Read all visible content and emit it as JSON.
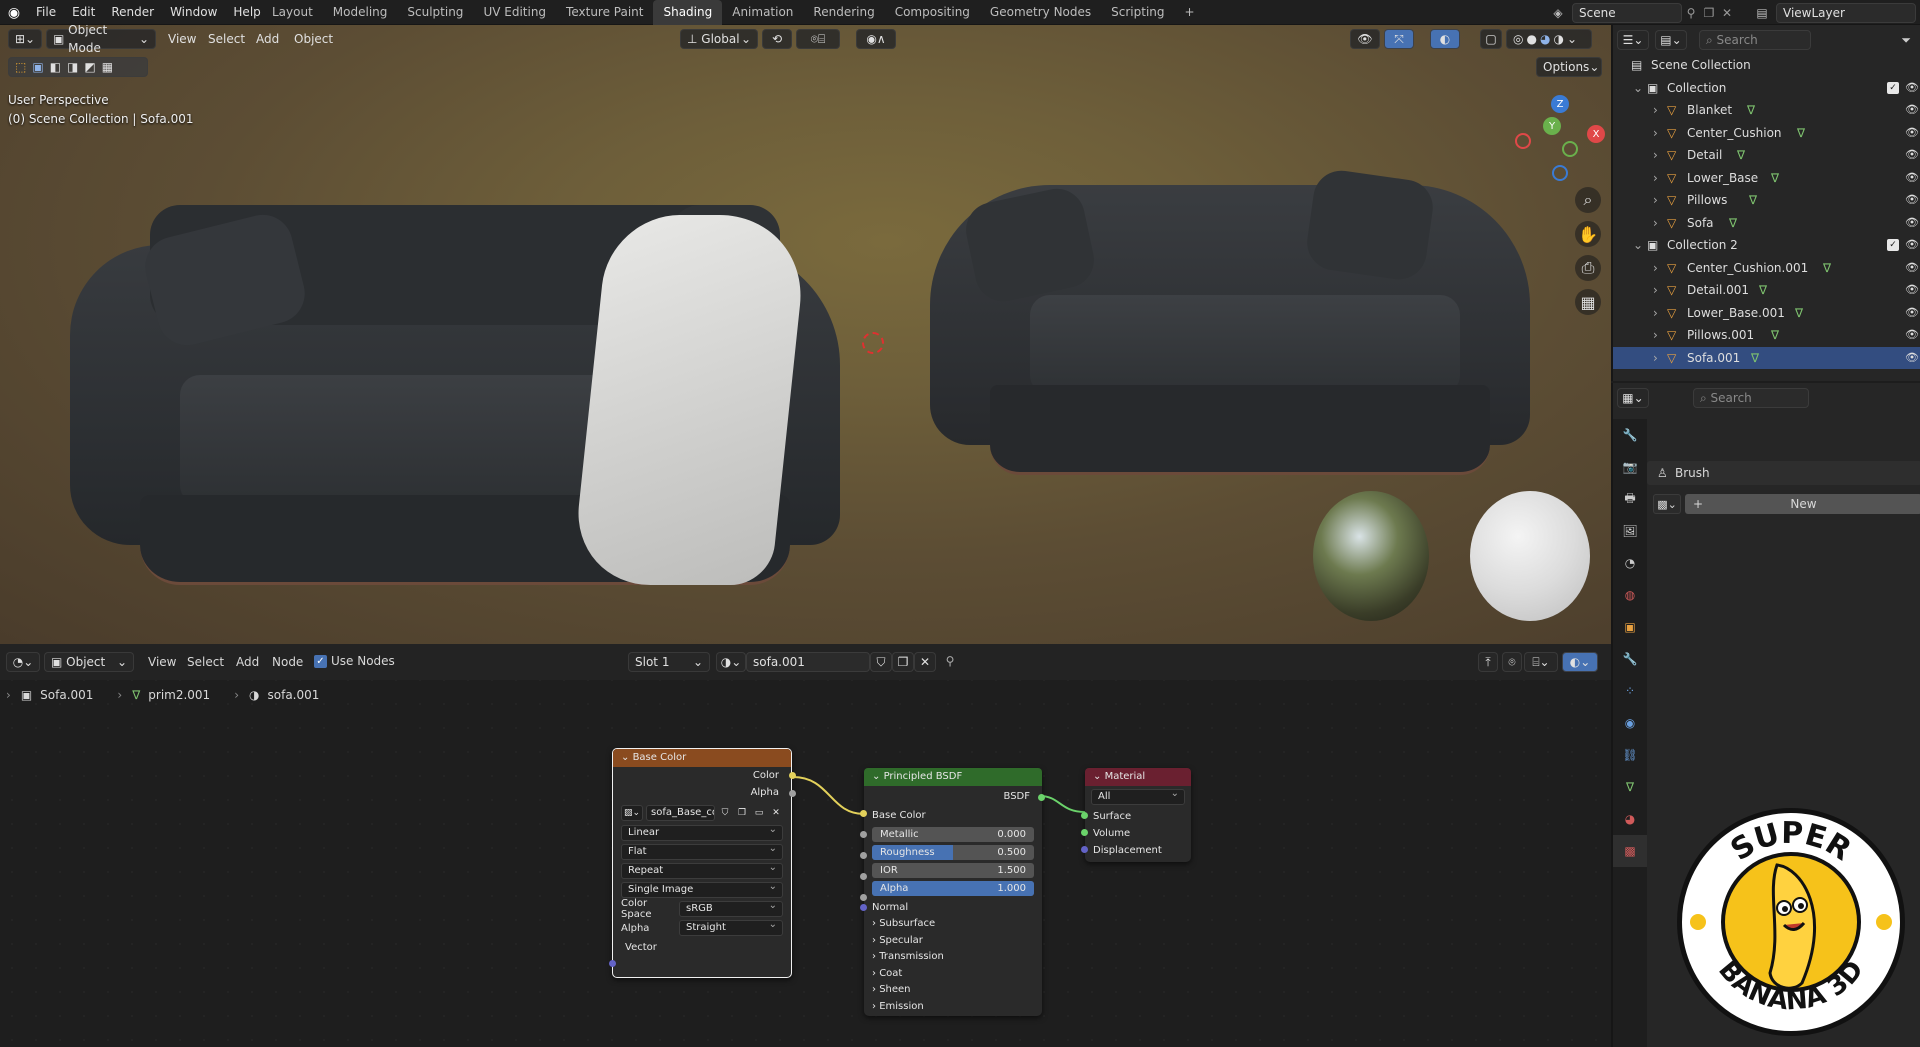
{
  "menu": [
    "File",
    "Edit",
    "Render",
    "Window",
    "Help"
  ],
  "workspaces": [
    "Layout",
    "Modeling",
    "Sculpting",
    "UV Editing",
    "Texture Paint",
    "Shading",
    "Animation",
    "Rendering",
    "Compositing",
    "Geometry Nodes",
    "Scripting"
  ],
  "active_workspace": "Shading",
  "scene_name": "Scene",
  "view_layer": "ViewLayer",
  "viewport": {
    "mode": "Object Mode",
    "menus": [
      "View",
      "Select",
      "Add",
      "Object"
    ],
    "transform_orientation": "Global",
    "options_label": "Options",
    "overlay_title": "User Perspective",
    "overlay_subtitle": "(0) Scene Collection | Sofa.001",
    "gizmo_axes": {
      "z": "Z",
      "y": "Y",
      "x": "X"
    }
  },
  "node_editor": {
    "type_label": "Object",
    "menus": [
      "View",
      "Select",
      "Add",
      "Node"
    ],
    "use_nodes_label": "Use Nodes",
    "use_nodes_checked": true,
    "slot": "Slot 1",
    "material": "sofa.001",
    "breadcrumb": [
      "Sofa.001",
      "prim2.001",
      "sofa.001"
    ],
    "image_node": {
      "title": "Base Color",
      "outputs": [
        "Color",
        "Alpha"
      ],
      "image_name": "sofa_Base_colo...",
      "interpolation": "Linear",
      "projection": "Flat",
      "extension": "Repeat",
      "source": "Single Image",
      "color_space_label": "Color Space",
      "color_space": "sRGB",
      "alpha_label": "Alpha",
      "alpha_mode": "Straight",
      "input": "Vector"
    },
    "bsdf_node": {
      "title": "Principled BSDF",
      "output": "BSDF",
      "base_color": "Base Color",
      "sliders": [
        {
          "label": "Metallic",
          "value": "0.000",
          "fraction": 0.0
        },
        {
          "label": "Roughness",
          "value": "0.500",
          "fraction": 0.5
        },
        {
          "label": "IOR",
          "value": "1.500",
          "fraction": 0.0
        },
        {
          "label": "Alpha",
          "value": "1.000",
          "fraction": 1.0
        }
      ],
      "normal": "Normal",
      "panels": [
        "Subsurface",
        "Specular",
        "Transmission",
        "Coat",
        "Sheen",
        "Emission"
      ]
    },
    "output_node": {
      "title": "Material Output",
      "target": "All",
      "inputs": [
        "Surface",
        "Volume",
        "Displacement"
      ]
    }
  },
  "outliner": {
    "search_placeholder": "Search",
    "root": "Scene Collection",
    "collections": [
      {
        "name": "Collection",
        "items": [
          "Blanket",
          "Center_Cushion",
          "Detail",
          "Lower_Base",
          "Pillows",
          "Sofa"
        ]
      },
      {
        "name": "Collection 2",
        "items": [
          "Center_Cushion.001",
          "Detail.001",
          "Lower_Base.001",
          "Pillows.001",
          "Sofa.001"
        ]
      }
    ],
    "selected": "Sofa.001"
  },
  "properties": {
    "search_placeholder": "Search",
    "brush_label": "Brush",
    "new_label": "New"
  },
  "logo": {
    "top_text": "SUPER",
    "bottom_text": "BANANA 3D"
  },
  "colors": {
    "image_node_header": "#8a4b1f",
    "bsdf_node_header": "#2f6b2a",
    "output_node_header": "#6a2030",
    "slider_fill": "#4772b3",
    "selection": "#e07b2a"
  }
}
